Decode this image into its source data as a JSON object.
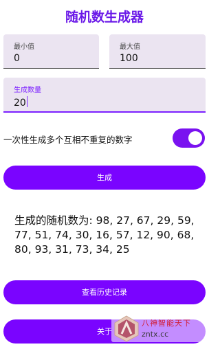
{
  "app": {
    "title": "随机数生成器"
  },
  "min_field": {
    "label": "最小值",
    "value": "0"
  },
  "max_field": {
    "label": "最大值",
    "value": "100"
  },
  "count_field": {
    "label": "生成数量",
    "value": "20"
  },
  "unique_toggle": {
    "label": "一次性生成多个互相不重复的数字",
    "on": true
  },
  "generate_button": {
    "label": "生成"
  },
  "result": {
    "text": "生成的随机数为: 98, 27, 67, 29, 59, 77, 51, 74, 30, 16, 57, 12, 90, 68, 80, 93, 31, 73, 34, 25"
  },
  "history_button": {
    "label": "查看历史记录"
  },
  "about_button": {
    "label": "关于"
  },
  "watermark": {
    "title": "八神智能天下",
    "url": "zntx.cc",
    "icon": "watermark-logo-icon"
  },
  "colors": {
    "accent": "#7a04ff",
    "field_bg": "#ebe4f1"
  }
}
